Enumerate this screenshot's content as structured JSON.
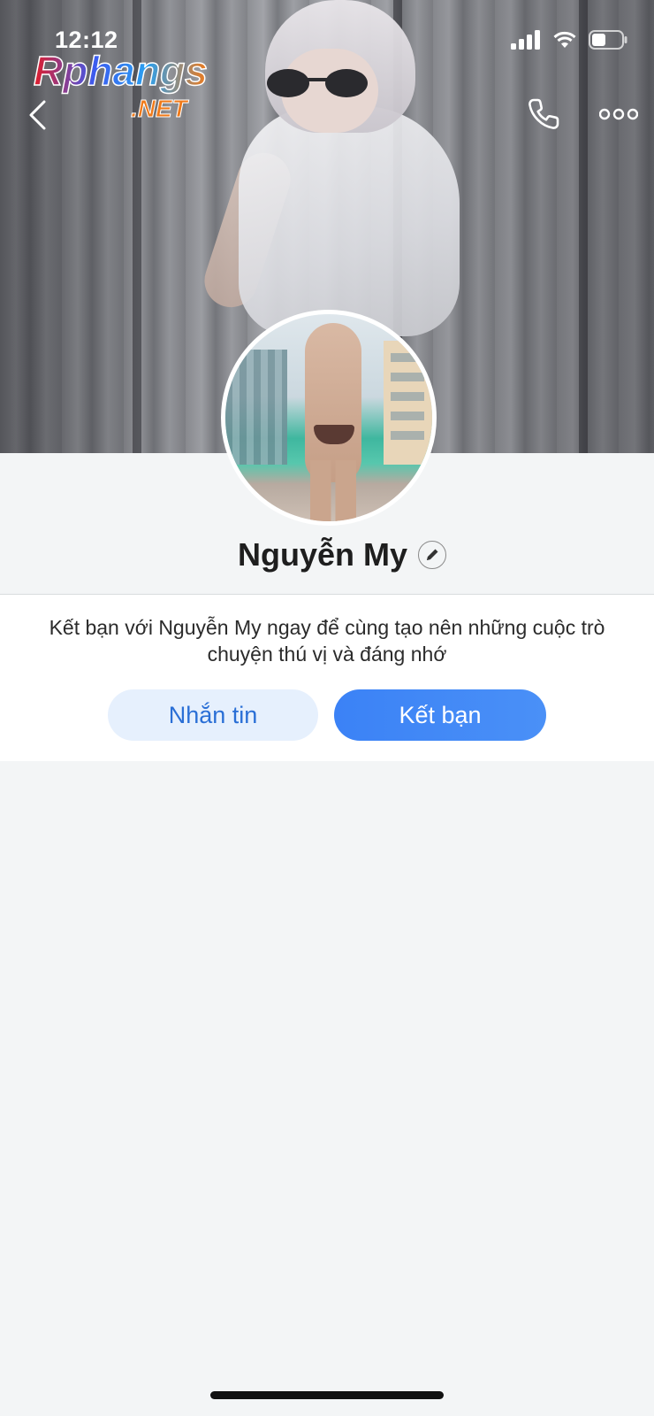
{
  "status_bar": {
    "time": "12:12",
    "icons": [
      "signal-icon",
      "wifi-icon",
      "battery-icon"
    ]
  },
  "watermark": {
    "line1": "Rphangs",
    "line2": ".NET"
  },
  "top_bar": {
    "back_icon": "chevron-left-icon",
    "call_icon": "phone-icon",
    "more_icon": "more-dots-icon"
  },
  "profile": {
    "name": "Nguyễn My",
    "edit_icon": "pencil-icon"
  },
  "friend_prompt": {
    "text": "Kết bạn với Nguyễn My ngay để cùng tạo nên những cuộc trò chuyện thú vị và đáng nhớ"
  },
  "actions": {
    "message_label": "Nhắn tin",
    "add_friend_label": "Kết bạn"
  },
  "colors": {
    "accent": "#3b82f6",
    "message_button_bg": "#e6f0fd",
    "message_button_text": "#2a6fd6",
    "background": "#f3f5f6"
  }
}
